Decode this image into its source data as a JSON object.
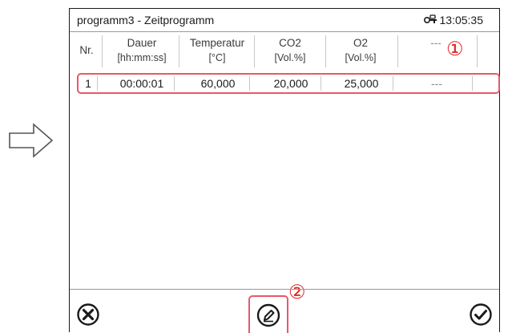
{
  "title": "programm3 - Zeitprogramm",
  "clock": {
    "time": "13:05:35",
    "icon": "lock-key-icon"
  },
  "columns": [
    {
      "line1": "Nr.",
      "line2": ""
    },
    {
      "line1": "Dauer",
      "line2": "[hh:mm:ss]"
    },
    {
      "line1": "Temperatur",
      "line2": "[°C]"
    },
    {
      "line1": "CO2",
      "line2": "[Vol.%]"
    },
    {
      "line1": "O2",
      "line2": "[Vol.%]"
    },
    {
      "line1": "---",
      "line2": ""
    }
  ],
  "rows": [
    {
      "nr": "1",
      "dauer": "00:00:01",
      "temperatur": "60,000",
      "co2": "20,000",
      "o2": "25,000",
      "extra": "---"
    }
  ],
  "callouts": {
    "row_marker": "①",
    "edit_marker": "②"
  },
  "buttons": {
    "cancel": "close-circle-icon",
    "edit": "pencil-circle-icon",
    "confirm": "check-circle-icon"
  },
  "colors": {
    "highlight": "#e8586b",
    "callout": "#e02020"
  }
}
